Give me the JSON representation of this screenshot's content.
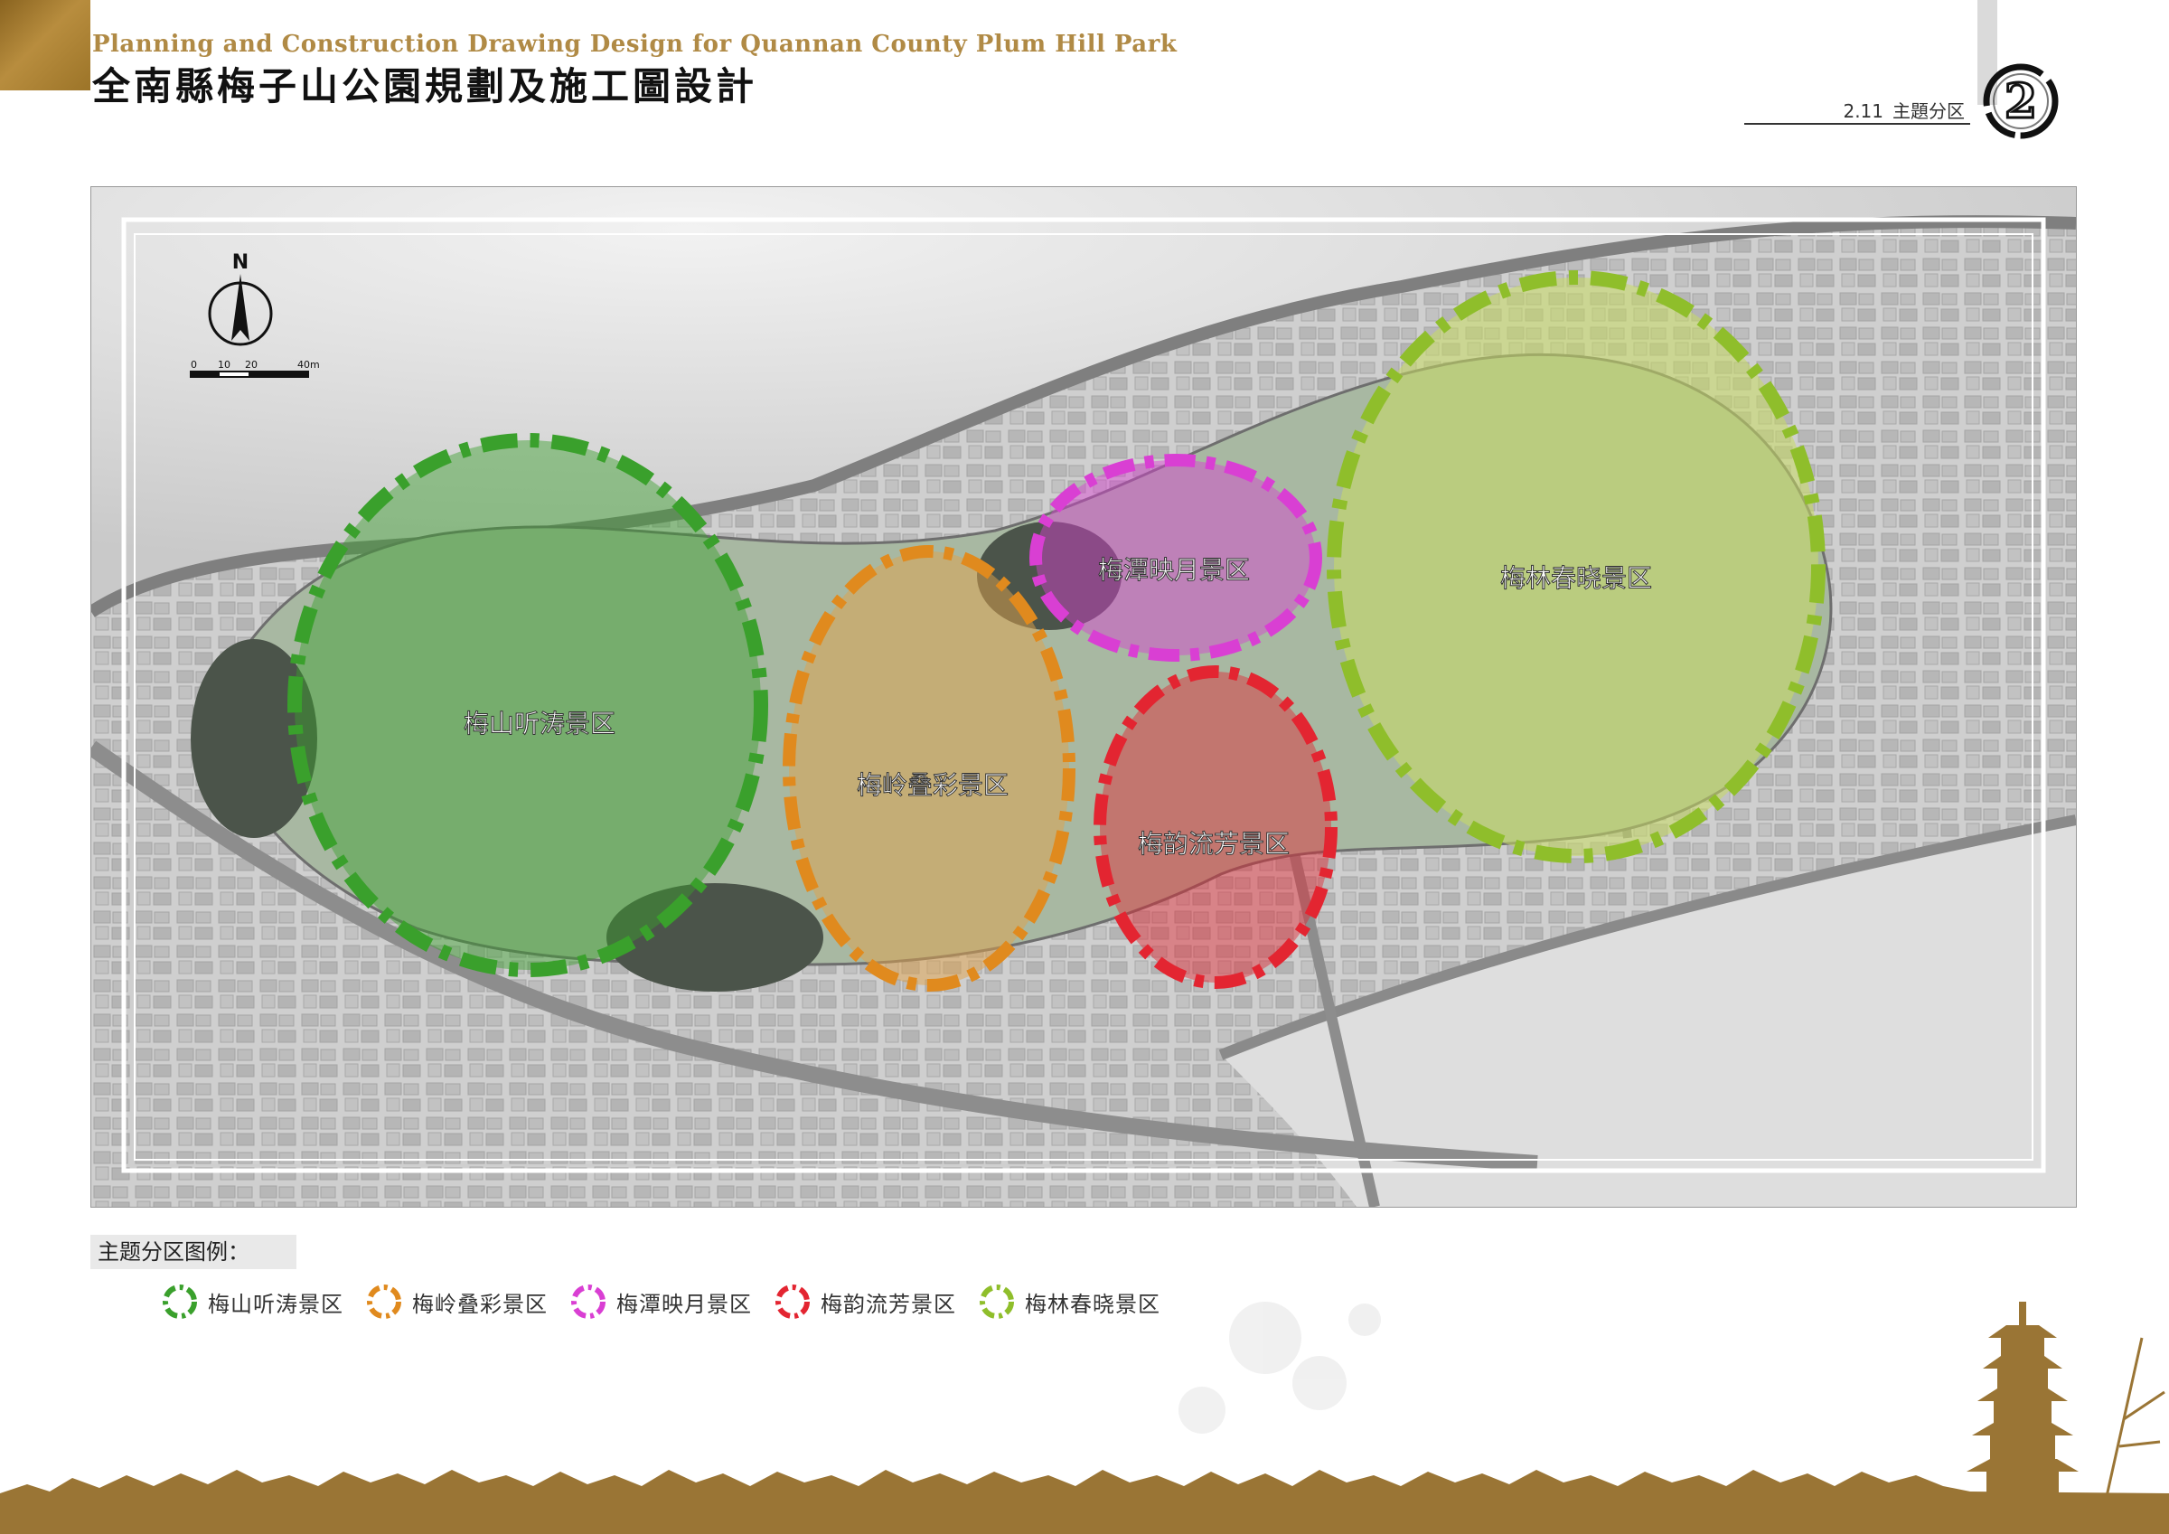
{
  "header": {
    "title_en": "Planning and Construction Drawing Design for Quannan County Plum Hill Park",
    "title_zh": "全南縣梅子山公園規劃及施工圖設計",
    "section_number": "2.11",
    "section_title": "主題分区",
    "chapter_badge": "2"
  },
  "map": {
    "north_label": "N",
    "scale_labels": [
      "0",
      "10",
      "20",
      "40m"
    ],
    "zones": [
      {
        "id": "meishan",
        "label": "梅山听涛景区",
        "color": "#3aa02c"
      },
      {
        "id": "meiling",
        "label": "梅岭叠彩景区",
        "color": "#e08a1e"
      },
      {
        "id": "meitan",
        "label": "梅潭映月景区",
        "color": "#d93fd3"
      },
      {
        "id": "meiyun",
        "label": "梅韵流芳景区",
        "color": "#e32531"
      },
      {
        "id": "meilin",
        "label": "梅林春晓景区",
        "color": "#8fbe2b"
      }
    ]
  },
  "legend": {
    "title": "主题分区图例：",
    "items": [
      {
        "label": "梅山听涛景区",
        "color": "#3aa02c"
      },
      {
        "label": "梅岭叠彩景区",
        "color": "#e08a1e"
      },
      {
        "label": "梅潭映月景区",
        "color": "#d93fd3"
      },
      {
        "label": "梅韵流芳景区",
        "color": "#e32531"
      },
      {
        "label": "梅林春晓景区",
        "color": "#8fbe2b"
      }
    ]
  },
  "colors": {
    "gold": "#b08a45",
    "footer_brown": "#9a7535"
  }
}
